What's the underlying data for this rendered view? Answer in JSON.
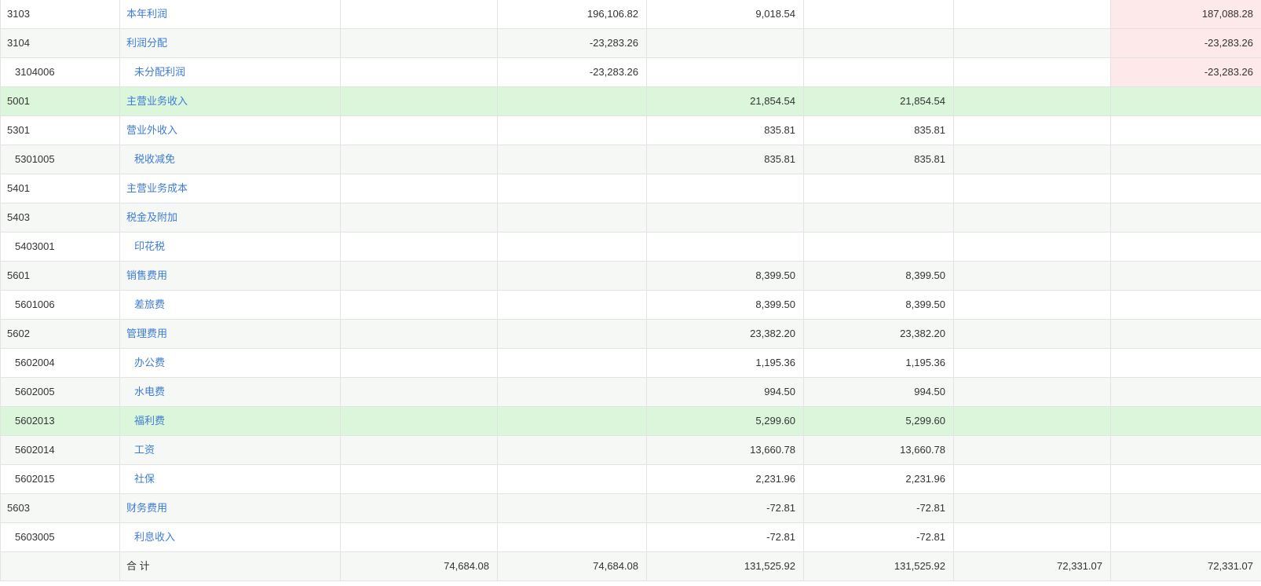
{
  "rows": [
    {
      "code": "3103",
      "name": "本年利润",
      "level": 1,
      "c1": "",
      "c2": "196,106.82",
      "c3": "9,018.54",
      "c4": "",
      "c5": "",
      "c6": "187,088.28",
      "flag": true,
      "highlight": false
    },
    {
      "code": "3104",
      "name": "利润分配",
      "level": 1,
      "c1": "",
      "c2": "-23,283.26",
      "c3": "",
      "c4": "",
      "c5": "",
      "c6": "-23,283.26",
      "flag": true,
      "highlight": false
    },
    {
      "code": "3104006",
      "name": "未分配利润",
      "level": 2,
      "c1": "",
      "c2": "-23,283.26",
      "c3": "",
      "c4": "",
      "c5": "",
      "c6": "-23,283.26",
      "flag": true,
      "highlight": false
    },
    {
      "code": "5001",
      "name": "主营业务收入",
      "level": 1,
      "c1": "",
      "c2": "",
      "c3": "21,854.54",
      "c4": "21,854.54",
      "c5": "",
      "c6": "",
      "flag": false,
      "highlight": true
    },
    {
      "code": "5301",
      "name": "营业外收入",
      "level": 1,
      "c1": "",
      "c2": "",
      "c3": "835.81",
      "c4": "835.81",
      "c5": "",
      "c6": "",
      "flag": false,
      "highlight": false
    },
    {
      "code": "5301005",
      "name": "税收减免",
      "level": 2,
      "c1": "",
      "c2": "",
      "c3": "835.81",
      "c4": "835.81",
      "c5": "",
      "c6": "",
      "flag": false,
      "highlight": false
    },
    {
      "code": "5401",
      "name": "主营业务成本",
      "level": 1,
      "c1": "",
      "c2": "",
      "c3": "",
      "c4": "",
      "c5": "",
      "c6": "",
      "flag": false,
      "highlight": false
    },
    {
      "code": "5403",
      "name": "税金及附加",
      "level": 1,
      "c1": "",
      "c2": "",
      "c3": "",
      "c4": "",
      "c5": "",
      "c6": "",
      "flag": false,
      "highlight": false
    },
    {
      "code": "5403001",
      "name": "印花税",
      "level": 2,
      "c1": "",
      "c2": "",
      "c3": "",
      "c4": "",
      "c5": "",
      "c6": "",
      "flag": false,
      "highlight": false
    },
    {
      "code": "5601",
      "name": "销售费用",
      "level": 1,
      "c1": "",
      "c2": "",
      "c3": "8,399.50",
      "c4": "8,399.50",
      "c5": "",
      "c6": "",
      "flag": false,
      "highlight": false
    },
    {
      "code": "5601006",
      "name": "差旅费",
      "level": 2,
      "c1": "",
      "c2": "",
      "c3": "8,399.50",
      "c4": "8,399.50",
      "c5": "",
      "c6": "",
      "flag": false,
      "highlight": false
    },
    {
      "code": "5602",
      "name": "管理费用",
      "level": 1,
      "c1": "",
      "c2": "",
      "c3": "23,382.20",
      "c4": "23,382.20",
      "c5": "",
      "c6": "",
      "flag": false,
      "highlight": false
    },
    {
      "code": "5602004",
      "name": "办公费",
      "level": 2,
      "c1": "",
      "c2": "",
      "c3": "1,195.36",
      "c4": "1,195.36",
      "c5": "",
      "c6": "",
      "flag": false,
      "highlight": false
    },
    {
      "code": "5602005",
      "name": "水电费",
      "level": 2,
      "c1": "",
      "c2": "",
      "c3": "994.50",
      "c4": "994.50",
      "c5": "",
      "c6": "",
      "flag": false,
      "highlight": false
    },
    {
      "code": "5602013",
      "name": "福利费",
      "level": 2,
      "c1": "",
      "c2": "",
      "c3": "5,299.60",
      "c4": "5,299.60",
      "c5": "",
      "c6": "",
      "flag": false,
      "highlight": true
    },
    {
      "code": "5602014",
      "name": "工资",
      "level": 2,
      "c1": "",
      "c2": "",
      "c3": "13,660.78",
      "c4": "13,660.78",
      "c5": "",
      "c6": "",
      "flag": false,
      "highlight": false
    },
    {
      "code": "5602015",
      "name": "社保",
      "level": 2,
      "c1": "",
      "c2": "",
      "c3": "2,231.96",
      "c4": "2,231.96",
      "c5": "",
      "c6": "",
      "flag": false,
      "highlight": false
    },
    {
      "code": "5603",
      "name": "财务费用",
      "level": 1,
      "c1": "",
      "c2": "",
      "c3": "-72.81",
      "c4": "-72.81",
      "c5": "",
      "c6": "",
      "flag": false,
      "highlight": false
    },
    {
      "code": "5603005",
      "name": "利息收入",
      "level": 2,
      "c1": "",
      "c2": "",
      "c3": "-72.81",
      "c4": "-72.81",
      "c5": "",
      "c6": "",
      "flag": false,
      "highlight": false
    }
  ],
  "total": {
    "label": "合 计",
    "c1": "74,684.08",
    "c2": "74,684.08",
    "c3": "131,525.92",
    "c4": "131,525.92",
    "c5": "72,331.07",
    "c6": "72,331.07"
  },
  "colors": {
    "link": "#3d7bd6",
    "row_highlight": "#dcf6dc",
    "cell_flag": "#fde9ea",
    "zebra": "#f6f8f6"
  }
}
